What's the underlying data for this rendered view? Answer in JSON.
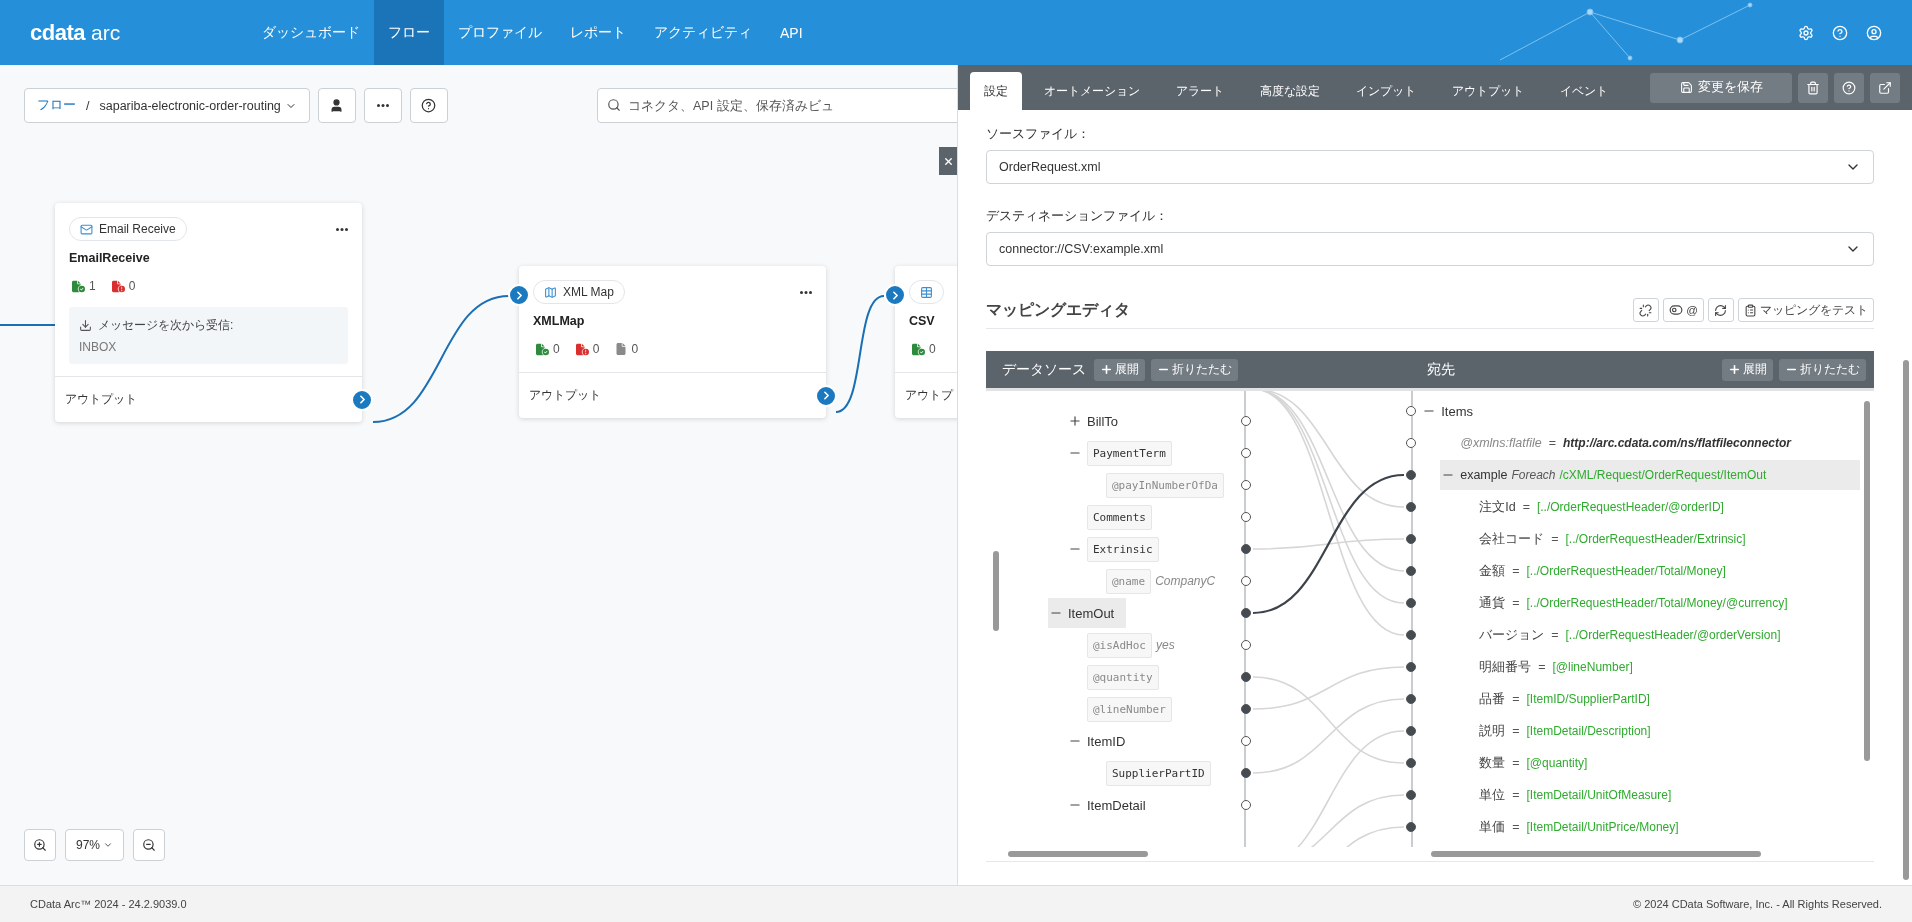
{
  "header": {
    "logo": {
      "brand": "cdata",
      "product": "arc"
    },
    "nav": [
      {
        "label": "ダッシュボード",
        "selected": false
      },
      {
        "label": "フロー",
        "selected": true
      },
      {
        "label": "プロファイル",
        "selected": false
      },
      {
        "label": "レポート",
        "selected": false
      },
      {
        "label": "アクティビティ",
        "selected": false
      },
      {
        "label": "API",
        "selected": false
      }
    ]
  },
  "flow_toolbar": {
    "breadcrumb": {
      "root": "フロー",
      "separator": "/",
      "current": "sapariba-electronic-order-routing"
    },
    "search": {
      "placeholder": "コネクタ、API 設定、保存済みビュ"
    }
  },
  "nodes": [
    {
      "kind": "email",
      "badge": "Email Receive",
      "title": "EmailReceive",
      "stats": [
        {
          "kind": "success",
          "count": "1"
        },
        {
          "kind": "error",
          "count": "0"
        }
      ],
      "info": {
        "label": "メッセージを次から受信:",
        "value": "INBOX"
      },
      "output": "アウトプット"
    },
    {
      "kind": "map",
      "badge": "XML Map",
      "title": "XMLMap",
      "stats": [
        {
          "kind": "success",
          "count": "0"
        },
        {
          "kind": "error",
          "count": "0"
        },
        {
          "kind": "pending",
          "count": "0"
        }
      ],
      "output": "アウトプット"
    },
    {
      "kind": "csv",
      "title": "CSV",
      "stats": [
        {
          "kind": "success",
          "count": "0"
        }
      ],
      "output": "アウトプ"
    }
  ],
  "zoom": {
    "level": "97%"
  },
  "panel": {
    "tabs": [
      {
        "label": "設定",
        "selected": true
      },
      {
        "label": "オートメーション",
        "selected": false
      },
      {
        "label": "アラート",
        "selected": false
      },
      {
        "label": "高度な設定",
        "selected": false
      },
      {
        "label": "インプット",
        "selected": false
      },
      {
        "label": "アウトプット",
        "selected": false
      },
      {
        "label": "イベント",
        "selected": false
      }
    ],
    "save": "変更を保存",
    "source_file": {
      "label": "ソースファイル：",
      "value": "OrderRequest.xml"
    },
    "destination_file": {
      "label": "デスティネーションファイル：",
      "value": "connector://CSV:example.xml"
    },
    "mapping": {
      "title": "マッピングエディタ",
      "toggle": "@",
      "test_button": "マッピングをテスト",
      "source": {
        "title": "データソース",
        "expand": "展開",
        "collapse": "折りたたむ",
        "tree": [
          {
            "children": [
              {
                "label": "BillTo",
                "kind": "element",
                "expanded": false,
                "mapped": false,
                "selected": false
              },
              {
                "label": "PaymentTerm",
                "kind": "field",
                "expanded": true,
                "mapped": false,
                "selected": false,
                "children": [
                  {
                    "label": "@payInNumberOfDa",
                    "kind": "attribute",
                    "mapped": false,
                    "selected": false
                  }
                ]
              },
              {
                "label": "Comments",
                "kind": "field",
                "mapped": false,
                "selected": false
              },
              {
                "label": "Extrinsic",
                "kind": "field",
                "expanded": true,
                "mapped": true,
                "selected": false,
                "children": [
                  {
                    "label": "@name",
                    "kind": "attribute",
                    "value": "CompanyC",
                    "mapped": false,
                    "selected": false
                  }
                ]
              }
            ]
          },
          {
            "label": "ItemOut",
            "kind": "element",
            "expanded": true,
            "mapped": true,
            "selected": true,
            "children": [
              {
                "label": "@isAdHoc",
                "kind": "attribute",
                "value": "yes",
                "mapped": false,
                "selected": false
              },
              {
                "label": "@quantity",
                "kind": "attribute",
                "mapped": true,
                "selected": false
              },
              {
                "label": "@lineNumber",
                "kind": "attribute",
                "mapped": true,
                "selected": false
              },
              {
                "label": "ItemID",
                "kind": "element",
                "expanded": true,
                "mapped": false,
                "selected": false,
                "children": [
                  {
                    "label": "SupplierPartID",
                    "kind": "field",
                    "mapped": true,
                    "selected": false
                  }
                ]
              },
              {
                "label": "ItemDetail",
                "kind": "element",
                "expanded": true,
                "mapped": false,
                "selected": false
              }
            ]
          }
        ]
      },
      "destination": {
        "title": "宛先",
        "expand": "展開",
        "collapse": "折りたたむ",
        "tree": [
          {
            "label": "Items",
            "kind": "element",
            "expanded": true,
            "mapped": false,
            "selected": false,
            "children": [
              {
                "label": "@xmlns:flatfile",
                "kind": "attribute",
                "operator": "=",
                "value": "http://arc.cdata.com/ns/flatfileconnector",
                "mapped": false,
                "selected": false
              },
              {
                "label": "example",
                "kind": "loop",
                "keyword": "Foreach",
                "value": "/cXML/Request/OrderRequest/ItemOut",
                "expanded": true,
                "mapped": true,
                "selected": true,
                "children": [
                  {
                    "label": "注文Id",
                    "kind": "field",
                    "operator": "=",
                    "value": "[../OrderRequestHeader/@orderID]",
                    "mapped": true,
                    "selected": false
                  },
                  {
                    "label": "会社コード",
                    "kind": "field",
                    "operator": "=",
                    "value": "[../OrderRequestHeader/Extrinsic]",
                    "mapped": true,
                    "selected": false
                  },
                  {
                    "label": "金額",
                    "kind": "field",
                    "operator": "=",
                    "value": "[../OrderRequestHeader/Total/Money]",
                    "mapped": true,
                    "selected": false
                  },
                  {
                    "label": "通貨",
                    "kind": "field",
                    "operator": "=",
                    "value": "[../OrderRequestHeader/Total/Money/@currency]",
                    "mapped": true,
                    "selected": false
                  },
                  {
                    "label": "バージョン",
                    "kind": "field",
                    "operator": "=",
                    "value": "[../OrderRequestHeader/@orderVersion]",
                    "mapped": true,
                    "selected": false
                  },
                  {
                    "label": "明細番号",
                    "kind": "field",
                    "operator": "=",
                    "value": "[@lineNumber]",
                    "mapped": true,
                    "selected": false
                  },
                  {
                    "label": "品番",
                    "kind": "field",
                    "operator": "=",
                    "value": "[ItemID/SupplierPartID]",
                    "mapped": true,
                    "selected": false
                  },
                  {
                    "label": "説明",
                    "kind": "field",
                    "operator": "=",
                    "value": "[ItemDetail/Description]",
                    "mapped": true,
                    "selected": false
                  },
                  {
                    "label": "数量",
                    "kind": "field",
                    "operator": "=",
                    "value": "[@quantity]",
                    "mapped": true,
                    "selected": false
                  },
                  {
                    "label": "単位",
                    "kind": "field",
                    "operator": "=",
                    "value": "[ItemDetail/UnitOfMeasure]",
                    "mapped": true,
                    "selected": false
                  },
                  {
                    "label": "単価",
                    "kind": "field",
                    "operator": "=",
                    "value": "[ItemDetail/UnitPrice/Money]",
                    "mapped": true,
                    "selected": false
                  }
                ]
              }
            ]
          }
        ]
      }
    }
  },
  "footer": {
    "version": "CData Arc™ 2024 - 24.2.9039.0",
    "copyright": "© 2024 CData Software, Inc. - All Rights Reserved."
  }
}
